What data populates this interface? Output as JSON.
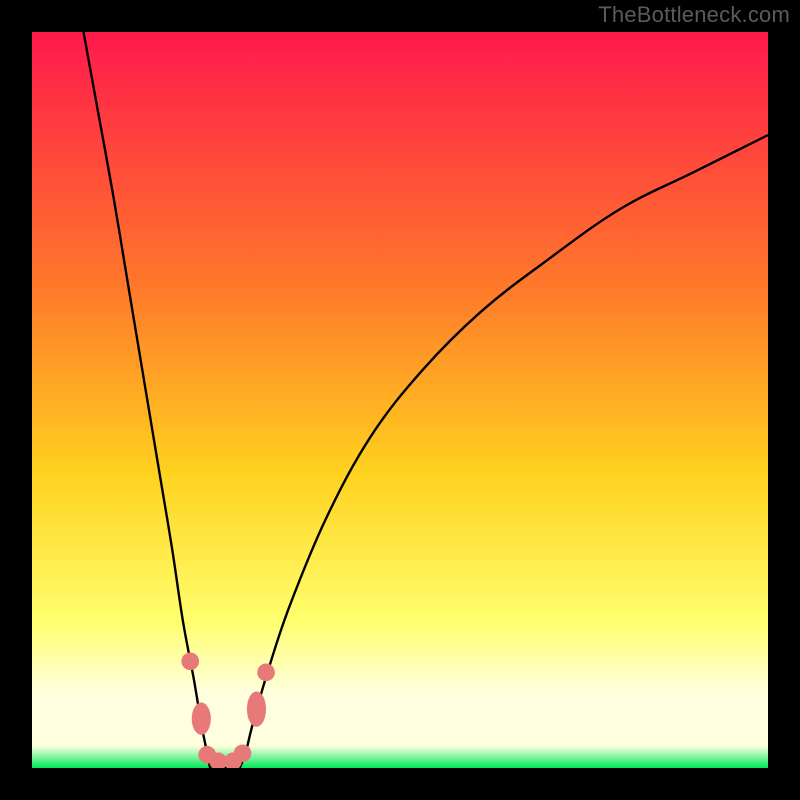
{
  "watermark": "TheBottleneck.com",
  "colors": {
    "frame": "#000000",
    "grad_top": "#ff1a4c",
    "grad_mid1": "#ff7a2a",
    "grad_mid2": "#ffd21f",
    "grad_mid3": "#ffff6e",
    "grad_pale": "#ffffe0",
    "grad_green": "#00e85a",
    "curve": "#000000",
    "marker": "#e77a79"
  },
  "chart_data": {
    "type": "line",
    "title": "",
    "xlabel": "",
    "ylabel": "",
    "xlim": [
      0,
      100
    ],
    "ylim": [
      0,
      100
    ],
    "left_curve": {
      "name": "left-branch",
      "x": [
        7,
        9,
        11,
        13,
        15,
        17,
        19,
        20.5,
        22,
        23,
        23.8,
        24.2
      ],
      "y": [
        100,
        89,
        78,
        66,
        54,
        42,
        30,
        20,
        12,
        6,
        2,
        0
      ]
    },
    "right_curve": {
      "name": "right-branch",
      "x": [
        28.2,
        29,
        30,
        32,
        35,
        40,
        46,
        53,
        61,
        70,
        80,
        90,
        100
      ],
      "y": [
        0,
        2,
        6,
        13,
        22,
        34,
        45,
        54,
        62,
        69,
        76,
        81,
        86
      ]
    },
    "floor_segment": {
      "x": [
        24.2,
        28.2
      ],
      "y": [
        0,
        0
      ]
    },
    "markers": [
      {
        "x": 21.5,
        "y": 14.5,
        "rx": 1.2,
        "ry": 1.2
      },
      {
        "x": 23.0,
        "y": 6.7,
        "rx": 1.3,
        "ry": 2.2
      },
      {
        "x": 23.8,
        "y": 1.8,
        "rx": 1.2,
        "ry": 1.2
      },
      {
        "x": 25.3,
        "y": 0.9,
        "rx": 1.2,
        "ry": 1.2
      },
      {
        "x": 27.3,
        "y": 0.9,
        "rx": 1.2,
        "ry": 1.2
      },
      {
        "x": 28.6,
        "y": 2.0,
        "rx": 1.2,
        "ry": 1.2
      },
      {
        "x": 30.5,
        "y": 8.0,
        "rx": 1.3,
        "ry": 2.4
      },
      {
        "x": 31.8,
        "y": 13.0,
        "rx": 1.2,
        "ry": 1.2
      }
    ]
  }
}
